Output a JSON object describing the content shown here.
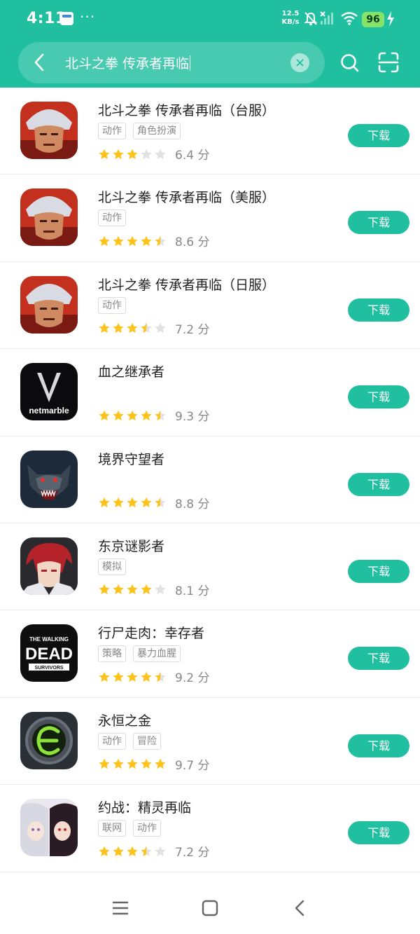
{
  "status_bar": {
    "time": "4:11",
    "net_speed_value": "12.5",
    "net_speed_unit": "KB/s",
    "battery": "96",
    "icons": [
      "sim-card-icon",
      "more-dots-icon",
      "mute-icon",
      "signal-icon",
      "wifi-icon",
      "battery-icon",
      "charging-icon"
    ]
  },
  "search": {
    "query": "北斗之拳 传承者再临"
  },
  "download_label": "下载",
  "apps": [
    {
      "name": "北斗之拳 传承者再临（台服）",
      "tags": [
        "动作",
        "角色扮演"
      ],
      "stars": 3,
      "rating": "6.4 分",
      "icon": "hokuto-fighter-icon"
    },
    {
      "name": "北斗之拳 传承者再临（美服）",
      "tags": [
        "动作"
      ],
      "stars": 4.5,
      "rating": "8.6 分",
      "icon": "hokuto-fighter-icon"
    },
    {
      "name": "北斗之拳 传承者再临（日服）",
      "tags": [
        "动作"
      ],
      "stars": 3.5,
      "rating": "7.2 分",
      "icon": "hokuto-fighter-icon"
    },
    {
      "name": "血之继承者",
      "tags": [],
      "stars": 4.5,
      "rating": "9.3 分",
      "icon": "netmarble-v-icon",
      "icon_text": "netmarble"
    },
    {
      "name": "境界守望者",
      "tags": [],
      "stars": 4.5,
      "rating": "8.8 分",
      "icon": "werewolf-icon"
    },
    {
      "name": "东京谜影者",
      "tags": [
        "模拟"
      ],
      "stars": 4,
      "rating": "8.1 分",
      "icon": "anime-red-hair-icon"
    },
    {
      "name": "行尸走肉：幸存者",
      "tags": [
        "策略",
        "暴力血腥"
      ],
      "stars": 4.5,
      "rating": "9.2 分",
      "icon": "walking-dead-icon",
      "icon_text": [
        "THE WALKING",
        "DEAD",
        "SURVIVORS"
      ]
    },
    {
      "name": "永恒之金",
      "tags": [
        "动作",
        "冒险"
      ],
      "stars": 5,
      "rating": "9.7 分",
      "icon": "eternium-e-icon"
    },
    {
      "name": "约战：精灵再临",
      "tags": [
        "联网",
        "动作"
      ],
      "stars": 3.5,
      "rating": "7.2 分",
      "icon": "anime-girls-icon"
    }
  ],
  "navbar": {
    "icons": [
      "menu-icon",
      "home-icon",
      "back-icon"
    ]
  },
  "colors": {
    "accent": "#1fbf9f",
    "star": "#ffc21a",
    "star_empty": "#e1e1e1"
  }
}
